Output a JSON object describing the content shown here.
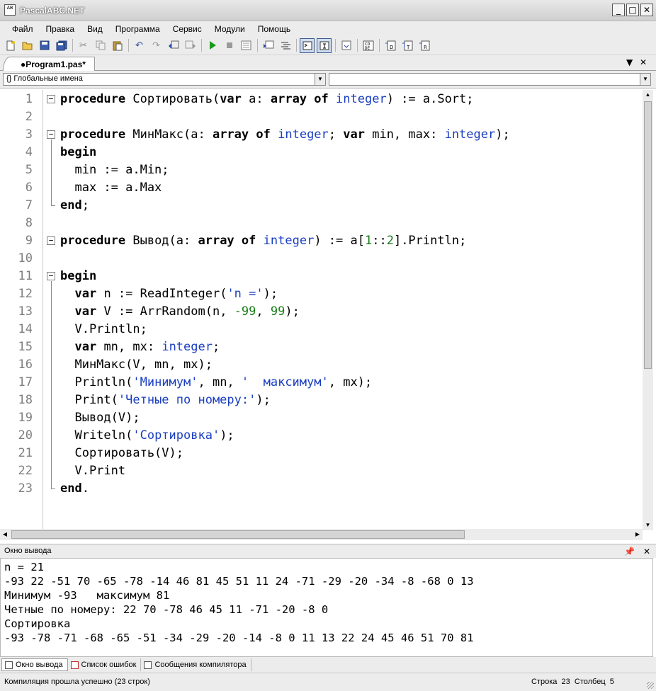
{
  "window": {
    "title": "PascalABC.NET",
    "app_icon_text": "AB",
    "minimize_icon": "minimize-icon",
    "maximize_icon": "maximize-icon",
    "close_icon": "close-icon"
  },
  "menu": [
    "Файл",
    "Правка",
    "Вид",
    "Программа",
    "Сервис",
    "Модули",
    "Помощь"
  ],
  "toolbar": {
    "buttons": [
      "new-file",
      "open",
      "save",
      "save-all",
      "cut",
      "copy",
      "paste",
      "undo",
      "redo",
      "navigate-back",
      "navigate-forward",
      "run",
      "stop",
      "debug-step",
      "comment",
      "uncomment",
      "toggle-output",
      "toggle-debug",
      "format-code",
      "code-templates",
      "step-over",
      "step-into",
      "step-return"
    ],
    "pressed": [
      "toggle-output",
      "toggle-debug"
    ]
  },
  "tab": {
    "label": "●Program1.pas*",
    "dropdown_icon": "dropdown-arrow-icon",
    "close_icon": "close-icon"
  },
  "scope_combo": {
    "text": "{} Глобальные имена",
    "arrow_icon": "combo-arrow-icon"
  },
  "member_combo": {
    "text": ""
  },
  "editor": {
    "line_numbers": [
      "1",
      "2",
      "3",
      "4",
      "5",
      "6",
      "7",
      "8",
      "9",
      "10",
      "11",
      "12",
      "13",
      "14",
      "15",
      "16",
      "17",
      "18",
      "19",
      "20",
      "21",
      "22",
      "23"
    ],
    "lines": [
      [
        {
          "t": "procedure",
          "c": "kw"
        },
        {
          "t": " Сортировать(",
          "c": ""
        },
        {
          "t": "var",
          "c": "kw"
        },
        {
          "t": " a: ",
          "c": ""
        },
        {
          "t": "array",
          "c": "kw"
        },
        {
          "t": " ",
          "c": ""
        },
        {
          "t": "of",
          "c": "kw"
        },
        {
          "t": " ",
          "c": ""
        },
        {
          "t": "integer",
          "c": "ty"
        },
        {
          "t": ") := a.Sort;",
          "c": ""
        }
      ],
      [],
      [
        {
          "t": "procedure",
          "c": "kw"
        },
        {
          "t": " МинМакс(a: ",
          "c": ""
        },
        {
          "t": "array",
          "c": "kw"
        },
        {
          "t": " ",
          "c": ""
        },
        {
          "t": "of",
          "c": "kw"
        },
        {
          "t": " ",
          "c": ""
        },
        {
          "t": "integer",
          "c": "ty"
        },
        {
          "t": "; ",
          "c": ""
        },
        {
          "t": "var",
          "c": "kw"
        },
        {
          "t": " min, max: ",
          "c": ""
        },
        {
          "t": "integer",
          "c": "ty"
        },
        {
          "t": ");",
          "c": ""
        }
      ],
      [
        {
          "t": "begin",
          "c": "kw"
        }
      ],
      [
        {
          "t": "  min := a.Min;",
          "c": ""
        }
      ],
      [
        {
          "t": "  max := a.Max",
          "c": ""
        }
      ],
      [
        {
          "t": "end",
          "c": "kw"
        },
        {
          "t": ";",
          "c": ""
        }
      ],
      [],
      [
        {
          "t": "procedure",
          "c": "kw"
        },
        {
          "t": " Вывод(a: ",
          "c": ""
        },
        {
          "t": "array",
          "c": "kw"
        },
        {
          "t": " ",
          "c": ""
        },
        {
          "t": "of",
          "c": "kw"
        },
        {
          "t": " ",
          "c": ""
        },
        {
          "t": "integer",
          "c": "ty"
        },
        {
          "t": ") := a[",
          "c": ""
        },
        {
          "t": "1",
          "c": "num"
        },
        {
          "t": "::",
          "c": ""
        },
        {
          "t": "2",
          "c": "num"
        },
        {
          "t": "].Println;",
          "c": ""
        }
      ],
      [],
      [
        {
          "t": "begin",
          "c": "kw"
        }
      ],
      [
        {
          "t": "  ",
          "c": ""
        },
        {
          "t": "var",
          "c": "kw"
        },
        {
          "t": " n := ReadInteger(",
          "c": ""
        },
        {
          "t": "'n ='",
          "c": "str"
        },
        {
          "t": ");",
          "c": ""
        }
      ],
      [
        {
          "t": "  ",
          "c": ""
        },
        {
          "t": "var",
          "c": "kw"
        },
        {
          "t": " V := ArrRandom(n, ",
          "c": ""
        },
        {
          "t": "-99",
          "c": "num"
        },
        {
          "t": ", ",
          "c": ""
        },
        {
          "t": "99",
          "c": "num"
        },
        {
          "t": ");",
          "c": ""
        }
      ],
      [
        {
          "t": "  V.Println;",
          "c": ""
        }
      ],
      [
        {
          "t": "  ",
          "c": ""
        },
        {
          "t": "var",
          "c": "kw"
        },
        {
          "t": " mn, mx: ",
          "c": ""
        },
        {
          "t": "integer",
          "c": "ty"
        },
        {
          "t": ";",
          "c": ""
        }
      ],
      [
        {
          "t": "  МинМакс(V, mn, mx);",
          "c": ""
        }
      ],
      [
        {
          "t": "  Println(",
          "c": ""
        },
        {
          "t": "'Минимум'",
          "c": "str"
        },
        {
          "t": ", mn, ",
          "c": ""
        },
        {
          "t": "'  максимум'",
          "c": "str"
        },
        {
          "t": ", mx);",
          "c": ""
        }
      ],
      [
        {
          "t": "  Print(",
          "c": ""
        },
        {
          "t": "'Четные по номеру:'",
          "c": "str"
        },
        {
          "t": ");",
          "c": ""
        }
      ],
      [
        {
          "t": "  Вывод(V);",
          "c": ""
        }
      ],
      [
        {
          "t": "  Writeln(",
          "c": ""
        },
        {
          "t": "'Сортировка'",
          "c": "str"
        },
        {
          "t": ");",
          "c": ""
        }
      ],
      [
        {
          "t": "  Сортировать(V);",
          "c": ""
        }
      ],
      [
        {
          "t": "  V.Print",
          "c": ""
        }
      ],
      [
        {
          "t": "end",
          "c": "kw"
        },
        {
          "t": ".",
          "c": ""
        }
      ]
    ]
  },
  "output_panel": {
    "title": "Окно вывода",
    "pin_icon": "pin-icon",
    "close_icon": "close-icon",
    "lines": [
      "n = 21",
      "-93 22 -51 70 -65 -78 -14 46 81 45 51 11 24 -71 -29 -20 -34 -8 -68 0 13",
      "Минимум -93   максимум 81",
      "Четные по номеру: 22 70 -78 46 45 11 -71 -20 -8 0",
      "Сортировка",
      "-93 -78 -71 -68 -65 -51 -34 -29 -20 -14 -8 0 11 13 22 24 45 46 51 70 81"
    ],
    "tabs": [
      "Окно вывода",
      "Список ошибок",
      "Сообщения компилятора"
    ]
  },
  "status": {
    "message": "Компиляция прошла успешно (23 строк)",
    "row_label": "Строка",
    "row_value": "23",
    "col_label": "Столбец",
    "col_value": "5"
  },
  "colors": {
    "keyword": "#000000",
    "type": "#1a3ec0",
    "string": "#1a3ec0",
    "number": "#1a7d1a",
    "line_number": "#7f7f7f"
  }
}
